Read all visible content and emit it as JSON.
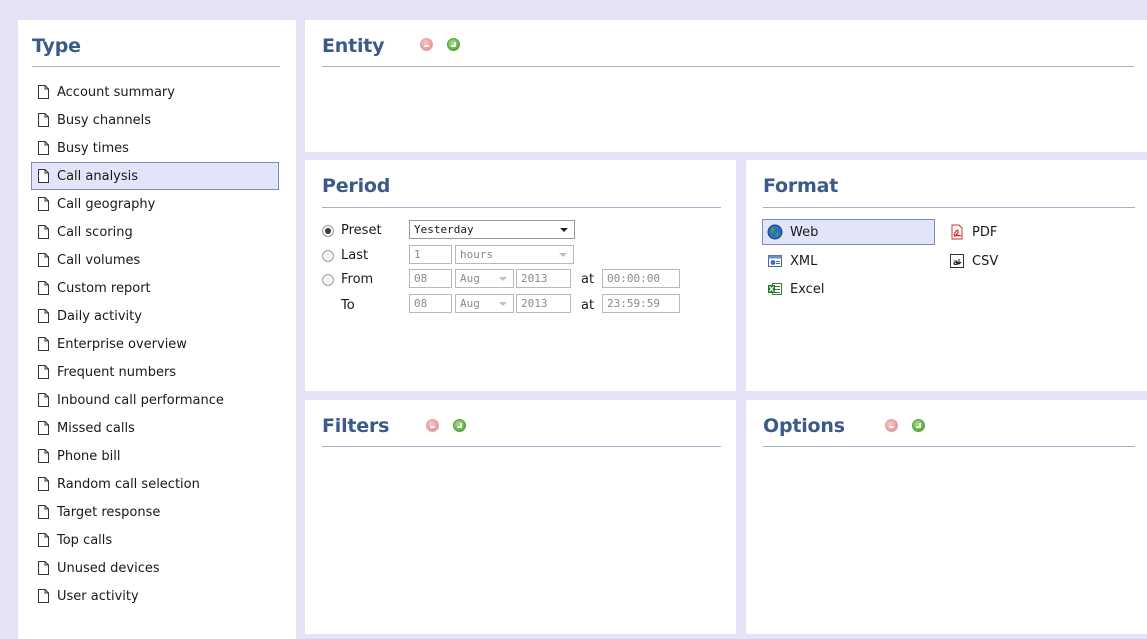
{
  "type_panel": {
    "title": "Type",
    "items": [
      {
        "label": "Account summary"
      },
      {
        "label": "Busy channels"
      },
      {
        "label": "Busy times"
      },
      {
        "label": "Call analysis",
        "selected": true
      },
      {
        "label": "Call geography"
      },
      {
        "label": "Call scoring"
      },
      {
        "label": "Call volumes"
      },
      {
        "label": "Custom report"
      },
      {
        "label": "Daily activity"
      },
      {
        "label": "Enterprise overview"
      },
      {
        "label": "Frequent numbers"
      },
      {
        "label": "Inbound call performance"
      },
      {
        "label": "Missed calls"
      },
      {
        "label": "Phone bill"
      },
      {
        "label": "Random call selection"
      },
      {
        "label": "Target response"
      },
      {
        "label": "Top calls"
      },
      {
        "label": "Unused devices"
      },
      {
        "label": "User activity"
      }
    ]
  },
  "entity_panel": {
    "title": "Entity"
  },
  "period_panel": {
    "title": "Period",
    "selected_mode": "preset",
    "preset": {
      "label": "Preset",
      "value": "Yesterday"
    },
    "last": {
      "label": "Last",
      "amount": "1",
      "unit": "hours"
    },
    "from": {
      "label": "From",
      "day": "08",
      "month": "Aug",
      "year": "2013",
      "at_label": "at",
      "time": "00:00:00"
    },
    "to": {
      "label": "To",
      "day": "08",
      "month": "Aug",
      "year": "2013",
      "at_label": "at",
      "time": "23:59:59"
    }
  },
  "format_panel": {
    "title": "Format",
    "selected": "Web",
    "options": {
      "web": "Web",
      "pdf": "PDF",
      "xml": "XML",
      "csv": "CSV",
      "excel": "Excel"
    }
  },
  "filters_panel": {
    "title": "Filters"
  },
  "options_panel": {
    "title": "Options"
  },
  "colors": {
    "background": "#e4e4f6",
    "title": "#3b5a8a",
    "selection_bg": "#e2e4f7",
    "selection_border": "#7f8bc8",
    "remove": "#e79a9a",
    "add": "#5fb040"
  }
}
